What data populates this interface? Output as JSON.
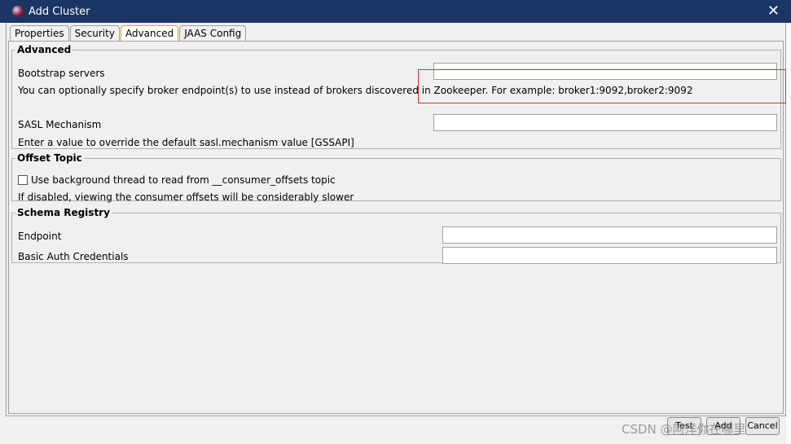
{
  "window": {
    "title": "Add Cluster"
  },
  "tabs": [
    {
      "label": "Properties"
    },
    {
      "label": "Security"
    },
    {
      "label": "Advanced",
      "active": true
    },
    {
      "label": "JAAS Config"
    }
  ],
  "advanced": {
    "legend": "Advanced",
    "bootstrap_label": "Bootstrap servers",
    "bootstrap_value": "",
    "bootstrap_help": "You can optionally specify broker endpoint(s) to use instead of brokers discovered in Zookeeper. For example: broker1:9092,broker2:9092",
    "sasl_label": "SASL Mechanism",
    "sasl_value": "",
    "sasl_help": "Enter a value to override the default sasl.mechanism value [GSSAPI]"
  },
  "offset": {
    "legend": "Offset Topic",
    "checkbox_label": "Use background thread to read from __consumer_offsets topic",
    "checked": false,
    "help": "If disabled, viewing the consumer offsets will be considerably slower"
  },
  "schema": {
    "legend": "Schema Registry",
    "endpoint_label": "Endpoint",
    "endpoint_value": "",
    "auth_label": "Basic Auth Credentials",
    "auth_value": ""
  },
  "buttons": {
    "test": "Test",
    "add": "Add",
    "cancel": "Cancel"
  },
  "watermark": "CSDN @阿洋你在哪里",
  "colors": {
    "titlebar": "#1b3564",
    "highlight": "#e03030",
    "active_tab": "#e8a030"
  }
}
